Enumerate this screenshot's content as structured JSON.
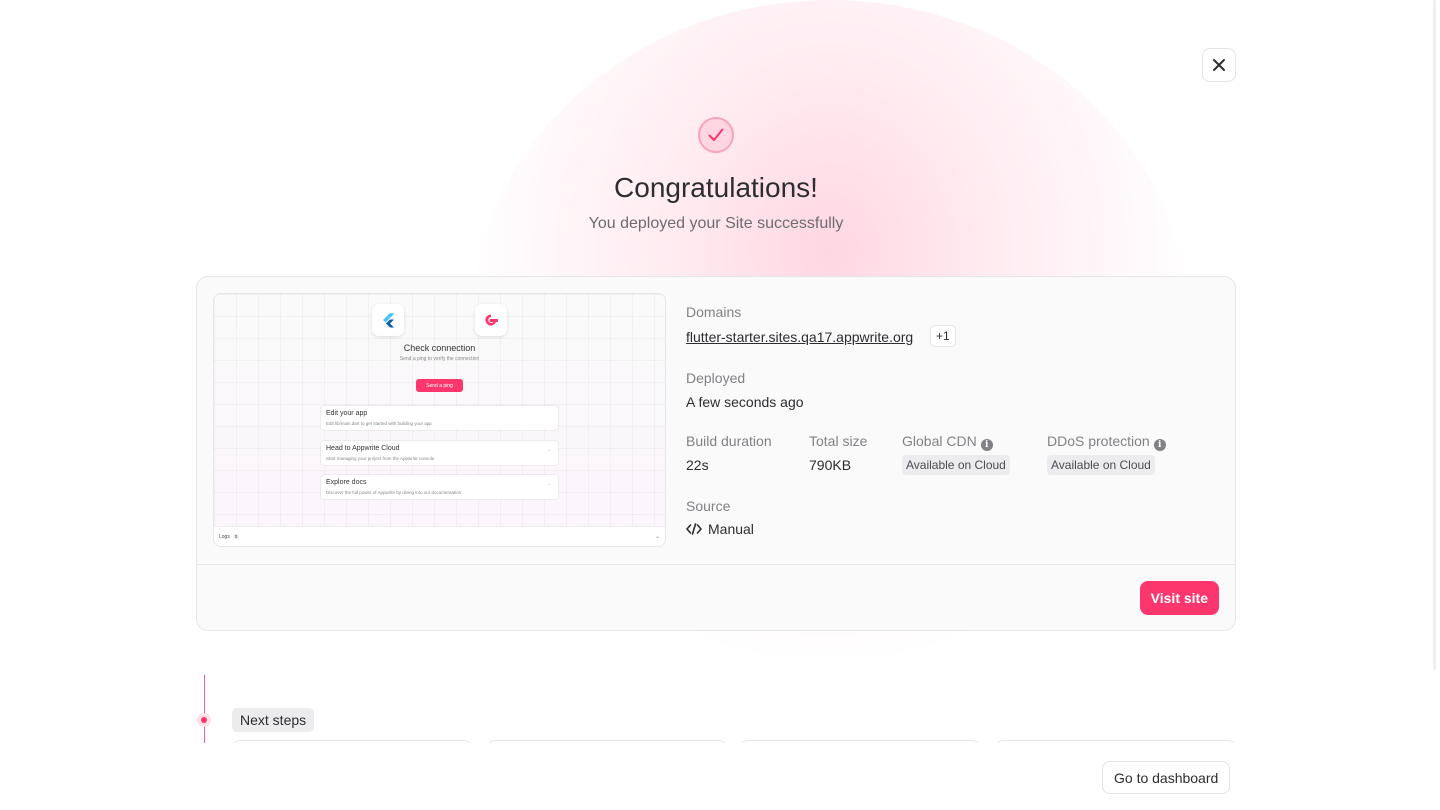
{
  "header": {
    "title": "Congratulations!",
    "subtitle": "You deployed your Site successfully",
    "close_icon": "close-icon",
    "success_icon": "check-icon"
  },
  "preview": {
    "title": "Check connection",
    "subtitle": "Send a ping to verify the connection",
    "ping_button": "Send a ping",
    "items": [
      {
        "title": "Edit your app",
        "desc": "Edit lib/main.dart to get started with building your app"
      },
      {
        "title": "Head to Appwrite Cloud",
        "desc": "Start managing your project from the Appwrite console"
      },
      {
        "title": "Explore docs",
        "desc": "Discover the full power of Appwrite by diving into our documentation"
      }
    ],
    "logs_label": "Logs",
    "logs_count": "0"
  },
  "details": {
    "domains_label": "Domains",
    "domain": "flutter-starter.sites.qa17.appwrite.org",
    "domain_extra": "+1",
    "deployed_label": "Deployed",
    "deployed_value": "A few seconds ago",
    "build_duration_label": "Build duration",
    "build_duration_value": "22s",
    "total_size_label": "Total size",
    "total_size_value": "790KB",
    "global_cdn_label": "Global CDN",
    "global_cdn_value": "Available on Cloud",
    "ddos_label": "DDoS protection",
    "ddos_value": "Available on Cloud",
    "source_label": "Source",
    "source_value": "Manual"
  },
  "actions": {
    "visit_site": "Visit site",
    "go_to_dashboard": "Go to dashboard"
  },
  "next_steps": {
    "label": "Next steps"
  },
  "colors": {
    "accent": "#fd366e",
    "text": "#2d2d31",
    "muted": "#818186"
  }
}
